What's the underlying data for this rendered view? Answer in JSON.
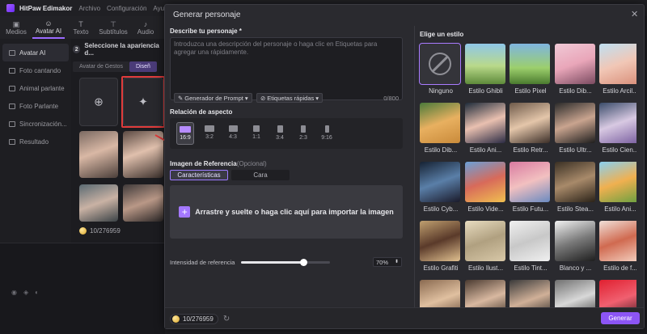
{
  "app": {
    "name": "HitPaw Edimakor",
    "menu": [
      "Archivo",
      "Configuración",
      "Ayuda"
    ]
  },
  "toolbar": [
    {
      "label": "Medios",
      "icon": "media-icon"
    },
    {
      "label": "Avatar AI",
      "icon": "avatar-icon"
    },
    {
      "label": "Texto",
      "icon": "text-icon"
    },
    {
      "label": "Subtítulos",
      "icon": "subtitles-icon"
    },
    {
      "label": "Audio",
      "icon": "audio-icon"
    }
  ],
  "leftnav": [
    {
      "label": "Avatar AI",
      "active": true
    },
    {
      "label": "Foto cantando"
    },
    {
      "label": "Animal parlante"
    },
    {
      "label": "Foto Parlante"
    },
    {
      "label": "Sincronización..."
    },
    {
      "label": "Resultado"
    }
  ],
  "avatar_panel": {
    "step": "2",
    "heading": "Seleccione la apariencia d...",
    "tabs": [
      "Avatar de Gestos",
      "Diseñ"
    ]
  },
  "background_credits": "10/276959",
  "modal": {
    "title": "Generar personaje",
    "description": {
      "label": "Describe tu personaje *",
      "placeholder": "Introduzca una descripción del personaje o haga clic en Etiquetas para agregar una rápidamente.",
      "counter": "0/800",
      "prompt_generator": "Generador de Prompt",
      "quick_tags": "Etiquetas rápidas"
    },
    "aspect": {
      "label": "Relación de aspecto",
      "options": [
        "16:9",
        "3:2",
        "4:3",
        "1:1",
        "3:4",
        "2:3",
        "9:16"
      ],
      "selected": "16:9"
    },
    "reference": {
      "label": "Imagen de Referencia",
      "optional": "(Opcional)",
      "tabs": [
        "Características",
        "Cara"
      ],
      "dropzone": "Arrastre y suelte o haga clic aquí para importar la imagen",
      "intensity_label": "Intensidad de referencia",
      "intensity_value": "70%",
      "intensity": 0.7
    },
    "styles": {
      "title": "Elige un estilo",
      "items": [
        "Ninguno",
        "Estilo Ghibli",
        "Estilo Pixel",
        "Estilo Dib...",
        "Estilo Arcil...",
        "Estilo Dib...",
        "Estilo Ani...",
        "Estilo Retr...",
        "Estilo Ultr...",
        "Estilo Cien...",
        "Estilo Cyb...",
        "Estilo Vide...",
        "Estilo Futu...",
        "Estilo Stea...",
        "Estilo Ani...",
        "Estilo Grafiti",
        "Estilo Ilust...",
        "Estilo Tint...",
        "Blanco y ...",
        "Estilo de f...",
        "",
        "",
        "",
        "",
        ""
      ],
      "selected": "Ninguno"
    },
    "footer": {
      "credits": "10/276959",
      "generate": "Generar"
    }
  }
}
